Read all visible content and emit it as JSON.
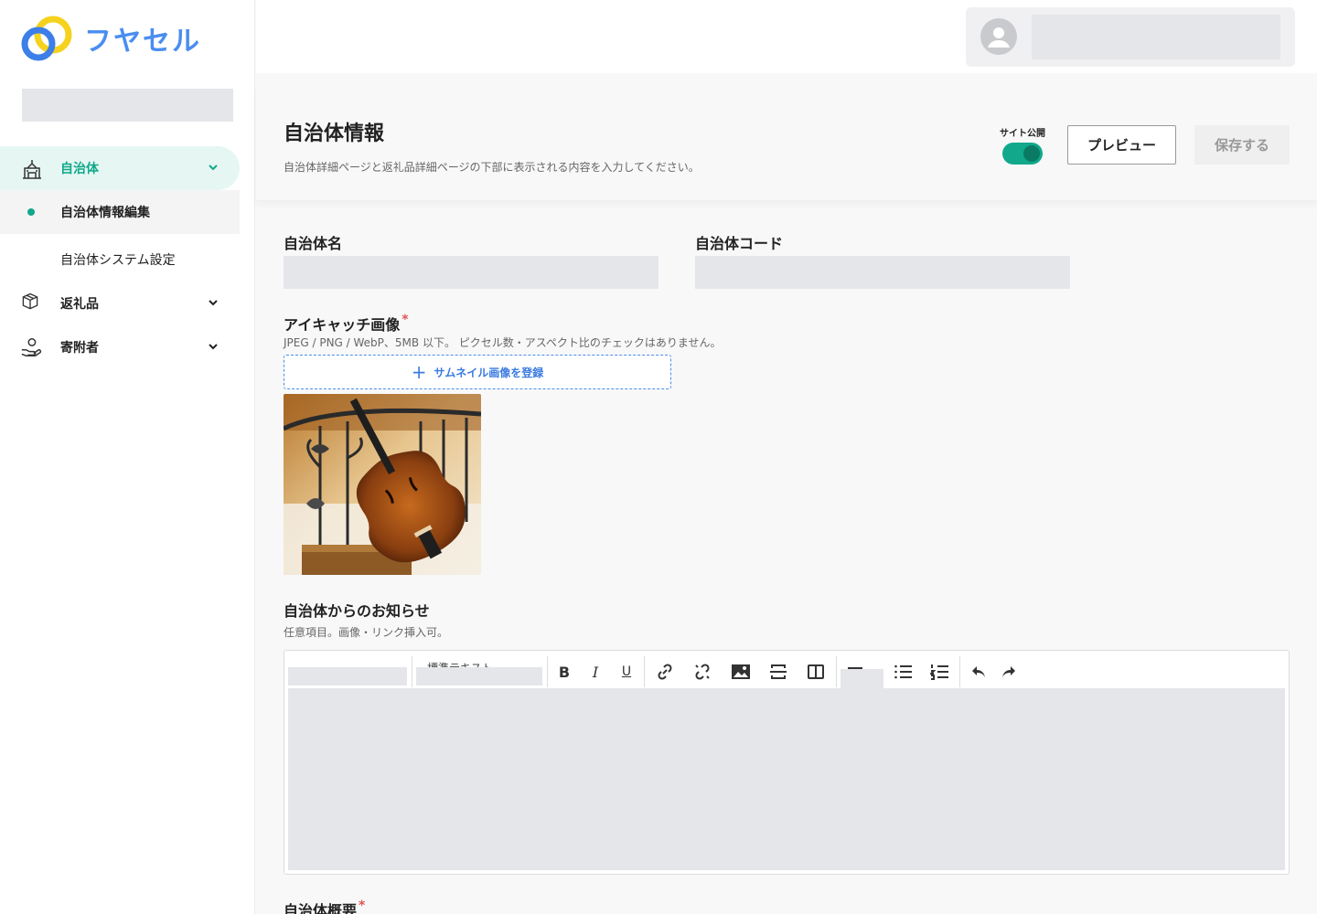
{
  "app": {
    "logo_text": "フヤセル"
  },
  "sidebar": {
    "nav": [
      {
        "label": "自治体",
        "icon": "city-hall-icon",
        "expanded": true
      },
      {
        "label": "返礼品",
        "icon": "package-icon",
        "expanded": false
      },
      {
        "label": "寄附者",
        "icon": "donor-hand-icon",
        "expanded": false
      }
    ],
    "sub": [
      {
        "label": "自治体情報編集",
        "active": true
      },
      {
        "label": "自治体システム設定",
        "active": false
      }
    ]
  },
  "header": {
    "title": "自治体情報",
    "description": "自治体詳細ページと返礼品詳細ページの下部に表示される内容を入力してください。",
    "publish_label": "サイト公開",
    "publish_on": true,
    "preview_label": "プレビュー",
    "save_label": "保存する"
  },
  "form": {
    "name_label": "自治体名",
    "code_label": "自治体コード",
    "eyecatch_label": "アイキャッチ画像",
    "required_mark": "*",
    "eyecatch_help": "JPEG / PNG / WebP、5MB 以下。 ピクセル数・アスペクト比のチェックはありません。",
    "upload_label": "サムネイル画像を登録",
    "news_label": "自治体からのお知らせ",
    "news_help": "任意項目。画像・リンク挿入可。",
    "overview_label": "自治体概要"
  },
  "editor": {
    "style_select": "標準テキスト",
    "tools": [
      "bold-icon",
      "italic-icon",
      "underline-icon",
      "link-icon",
      "unlink-icon",
      "image-icon",
      "page-break-icon",
      "columns-icon",
      "align-icon",
      "bullet-list-icon",
      "numbered-list-icon",
      "undo-icon",
      "redo-icon"
    ]
  },
  "colors": {
    "accent": "#11a88b",
    "link_blue": "#3b7be0",
    "logo_yellow": "#f5d21e",
    "logo_blue": "#3d7fe8"
  }
}
